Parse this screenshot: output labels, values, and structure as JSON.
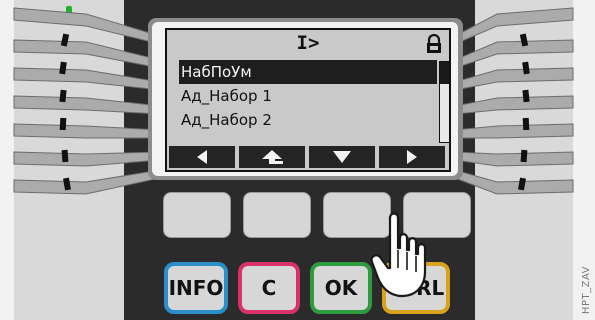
{
  "screen": {
    "title": "I>",
    "lock_icon": "lock-icon",
    "items": [
      {
        "label": "НабПоУм",
        "selected": true
      },
      {
        "label": "Ад_Набор 1",
        "selected": false
      },
      {
        "label": "Ад_Набор 2",
        "selected": false
      }
    ],
    "softkeys": [
      {
        "name": "softkey-left",
        "icon": "arrow-left-icon"
      },
      {
        "name": "softkey-up-level",
        "icon": "arrow-up-level-icon"
      },
      {
        "name": "softkey-down",
        "icon": "arrow-down-icon"
      },
      {
        "name": "softkey-right",
        "icon": "arrow-right-icon"
      }
    ]
  },
  "keys": {
    "info": "INFO",
    "c": "C",
    "ok": "OK",
    "ctrl": "CTRL"
  },
  "colors": {
    "info_border": "#2a8fc9",
    "c_border": "#d9326b",
    "ok_border": "#2e9b3f",
    "ctrl_border": "#d9a21a",
    "led": "#18b42a"
  },
  "pointer": "hand-pointer-icon",
  "watermark": "HPT_ZAV"
}
